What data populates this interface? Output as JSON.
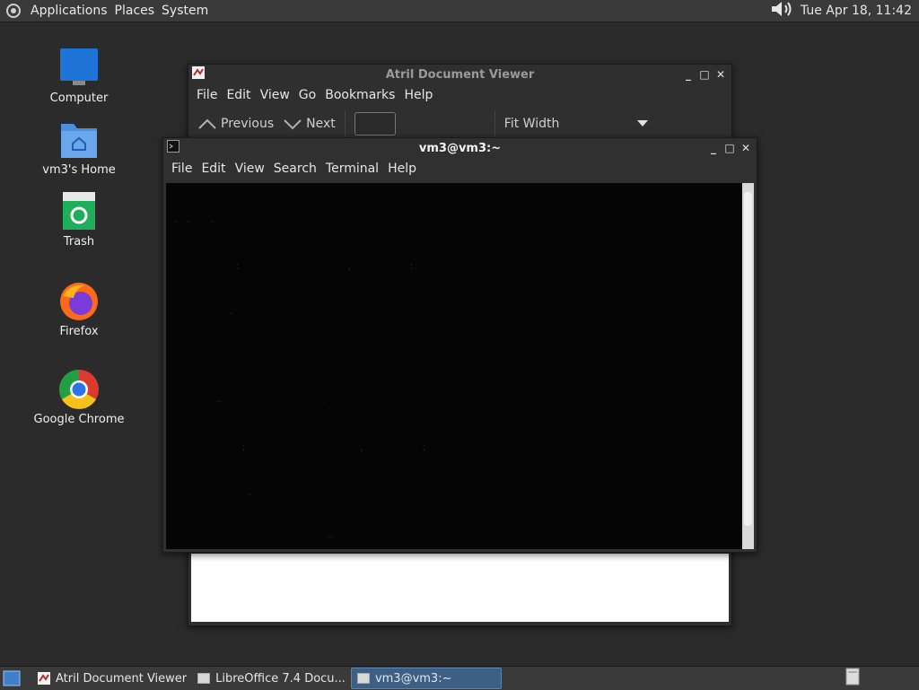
{
  "top_panel": {
    "menus": [
      "Applications",
      "Places",
      "System"
    ],
    "clock": "Tue Apr 18, 11:42"
  },
  "desktop": {
    "icons": [
      {
        "label": "Computer",
        "icon": "monitor-icon"
      },
      {
        "label": "vm3's Home",
        "icon": "home-folder-icon"
      },
      {
        "label": "Trash",
        "icon": "trash-icon"
      },
      {
        "label": "Firefox",
        "icon": "firefox-icon"
      },
      {
        "label": "Google Chrome",
        "icon": "chrome-icon"
      }
    ]
  },
  "atril": {
    "title": "Atril Document Viewer",
    "menus": [
      "File",
      "Edit",
      "View",
      "Go",
      "Bookmarks",
      "Help"
    ],
    "previous_label": "Previous",
    "next_label": "Next",
    "page_value": "",
    "zoom_value": "Fit Width"
  },
  "terminal": {
    "title": "vm3@vm3:~",
    "menus": [
      "File",
      "Edit",
      "View",
      "Search",
      "Terminal",
      "Help"
    ],
    "lines": [
      " - -   -        ",
      "           :                 ,         :                  ",
      "          .               ",
      "                          ",
      "        ~     -          -  ",
      "            :                  ,         :                  ",
      "             .               ",
      "                          ~  ",
      "        ~     -          -  "
    ]
  },
  "taskbar": {
    "tasks": [
      {
        "label": "Atril Document Viewer",
        "active": false
      },
      {
        "label": "LibreOffice 7.4 Docu...",
        "active": false
      },
      {
        "label": "vm3@vm3:~",
        "active": true
      }
    ]
  },
  "colors": {
    "desktop_bg": "#2b2b2b",
    "panel_bg": "#3a3a3a",
    "active_task": "#3b5f85"
  }
}
